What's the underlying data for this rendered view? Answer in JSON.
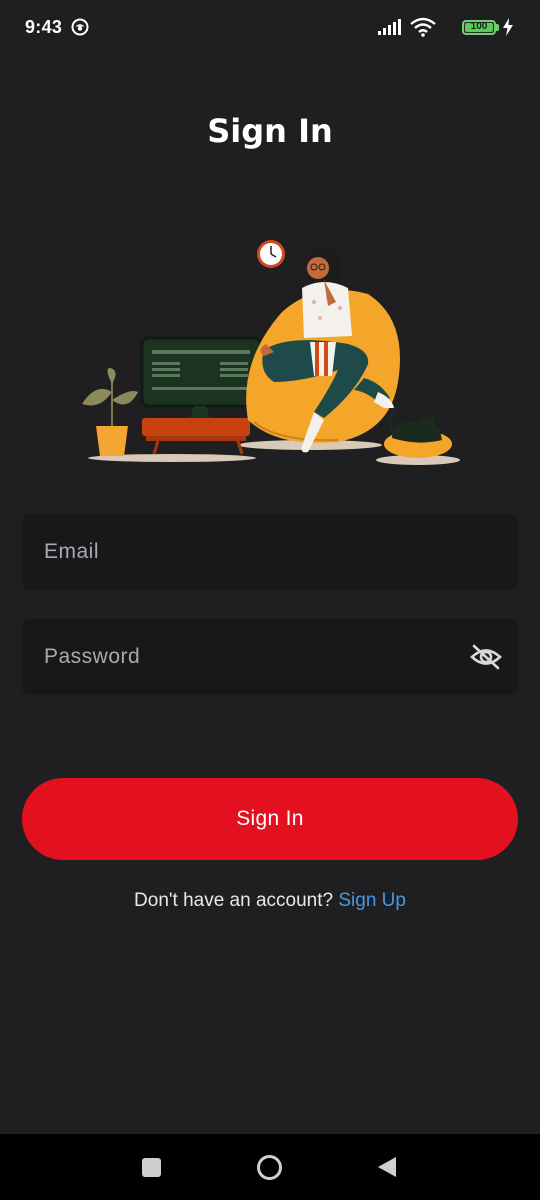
{
  "status_bar": {
    "time": "9:43",
    "battery": "100",
    "icons": [
      "app-notification-icon",
      "signal-icon",
      "wifi-icon",
      "battery-icon",
      "charging-bolt-icon"
    ]
  },
  "page": {
    "title": "Sign In"
  },
  "form": {
    "email": {
      "placeholder": "Email",
      "value": ""
    },
    "password": {
      "placeholder": "Password",
      "value": "",
      "toggle_icon": "eye-off-icon"
    },
    "submit_label": "Sign In"
  },
  "signup": {
    "prompt": "Don't have an account?",
    "link_label": "Sign Up"
  },
  "nav_bar": {
    "icons": [
      "recent-apps-icon",
      "home-icon",
      "back-icon"
    ]
  },
  "colors": {
    "background": "#1f1f22",
    "input_background": "#18181b",
    "primary": "#e31120",
    "link": "#3f9be8",
    "battery": "#5ec85a"
  }
}
